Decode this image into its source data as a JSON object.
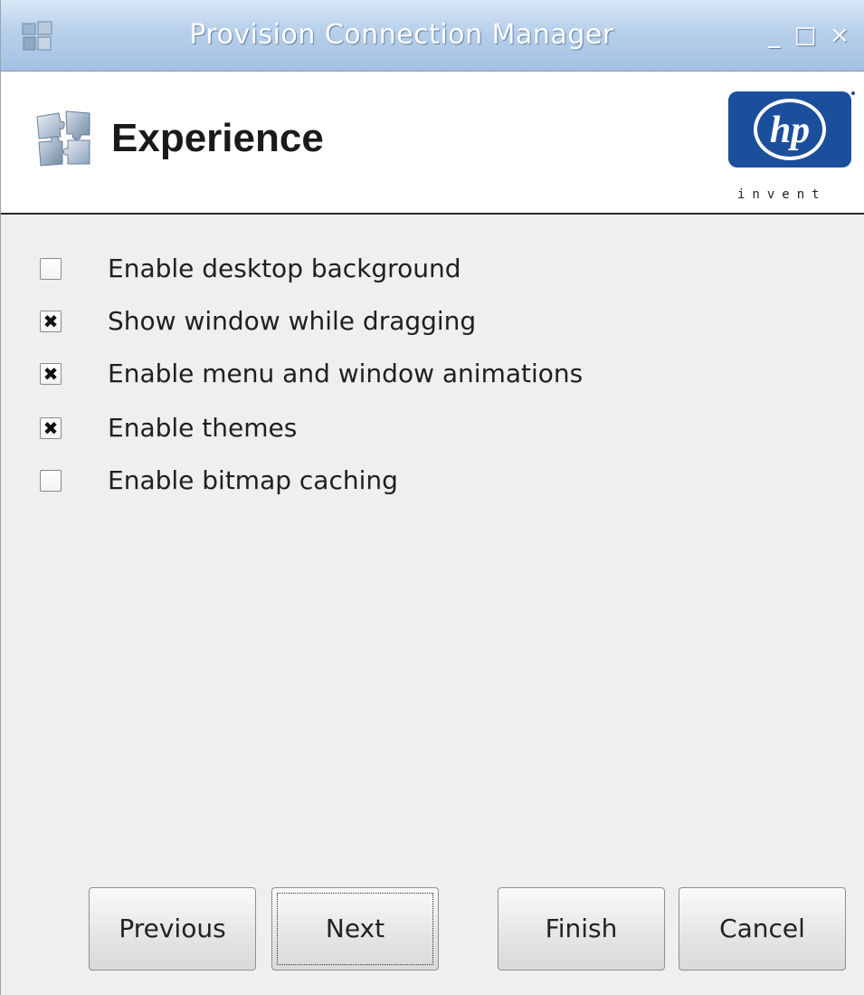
{
  "window": {
    "title": "Provision Connection Manager",
    "controls": {
      "minimize": "_",
      "maximize": "□",
      "close": "×"
    }
  },
  "header": {
    "title": "Experience",
    "logo_text": "invent"
  },
  "options": [
    {
      "label": "Enable desktop background",
      "checked": false
    },
    {
      "label": "Show window while dragging",
      "checked": true
    },
    {
      "label": "Enable menu and window animations",
      "checked": true
    },
    {
      "label": "Enable themes",
      "checked": true
    },
    {
      "label": "Enable bitmap caching",
      "checked": false
    }
  ],
  "check_mark": "✖",
  "buttons": {
    "previous": "Previous",
    "next": "Next",
    "finish": "Finish",
    "cancel": "Cancel"
  },
  "colors": {
    "titlebar": "#a4c1e3",
    "hp_blue": "#1b4f9c",
    "background": "#efefef"
  }
}
